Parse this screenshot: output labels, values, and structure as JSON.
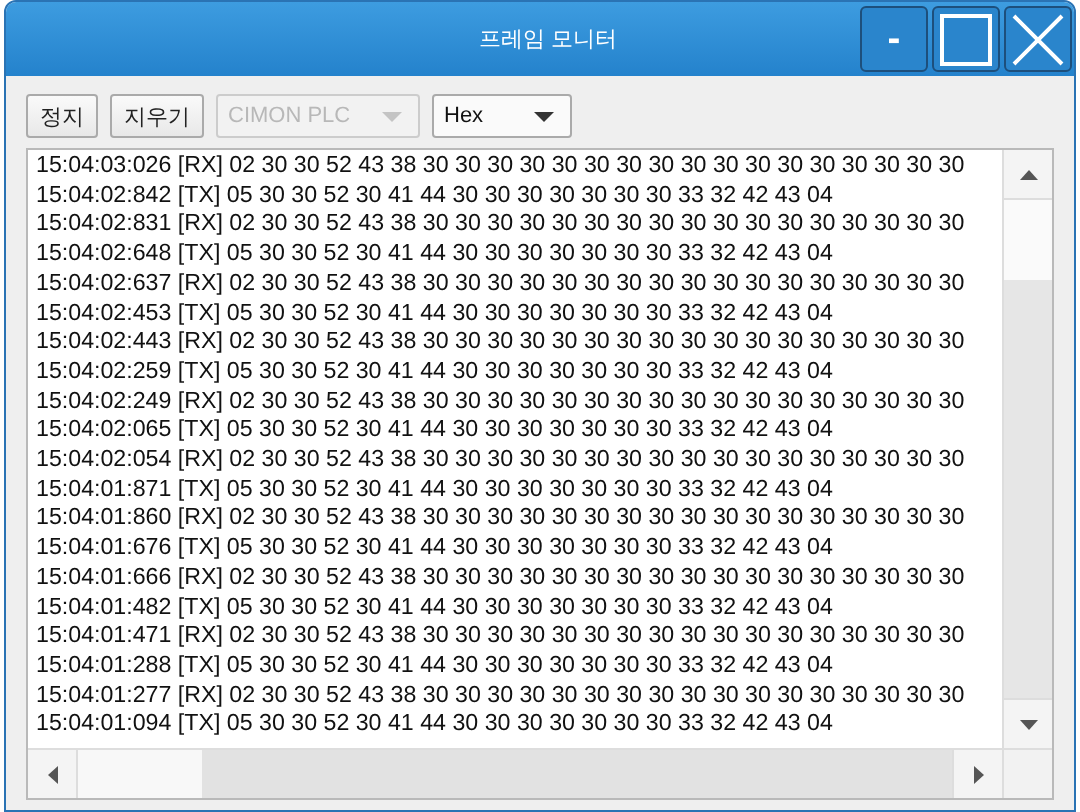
{
  "window": {
    "title": "프레임 모니터",
    "controls": [
      {
        "kind": "minimize",
        "label": "-"
      },
      {
        "kind": "maximize"
      },
      {
        "kind": "close"
      }
    ]
  },
  "toolbar": {
    "buttons": [
      "정지",
      "지우기"
    ],
    "combos": [
      {
        "value": "CIMON PLC",
        "disabled": true
      },
      {
        "value": "Hex",
        "disabled": false
      }
    ]
  },
  "log": {
    "lines": [
      "15:04:03:026 [RX] 02 30 30 52 43 38 30 30 30 30 30 30 30 30 30 30 30 30 30 30 30 30 30",
      "15:04:02:842 [TX] 05 30 30 52 30 41 44 30 30 30 30 30 30 30 33 32 42 43 04",
      "15:04:02:831 [RX] 02 30 30 52 43 38 30 30 30 30 30 30 30 30 30 30 30 30 30 30 30 30 30",
      "15:04:02:648 [TX] 05 30 30 52 30 41 44 30 30 30 30 30 30 30 33 32 42 43 04",
      "15:04:02:637 [RX] 02 30 30 52 43 38 30 30 30 30 30 30 30 30 30 30 30 30 30 30 30 30 30",
      "15:04:02:453 [TX] 05 30 30 52 30 41 44 30 30 30 30 30 30 30 33 32 42 43 04",
      "15:04:02:443 [RX] 02 30 30 52 43 38 30 30 30 30 30 30 30 30 30 30 30 30 30 30 30 30 30",
      "15:04:02:259 [TX] 05 30 30 52 30 41 44 30 30 30 30 30 30 30 33 32 42 43 04",
      "15:04:02:249 [RX] 02 30 30 52 43 38 30 30 30 30 30 30 30 30 30 30 30 30 30 30 30 30 30",
      "15:04:02:065 [TX] 05 30 30 52 30 41 44 30 30 30 30 30 30 30 33 32 42 43 04",
      "15:04:02:054 [RX] 02 30 30 52 43 38 30 30 30 30 30 30 30 30 30 30 30 30 30 30 30 30 30",
      "15:04:01:871 [TX] 05 30 30 52 30 41 44 30 30 30 30 30 30 30 33 32 42 43 04",
      "15:04:01:860 [RX] 02 30 30 52 43 38 30 30 30 30 30 30 30 30 30 30 30 30 30 30 30 30 30",
      "15:04:01:676 [TX] 05 30 30 52 30 41 44 30 30 30 30 30 30 30 33 32 42 43 04",
      "15:04:01:666 [RX] 02 30 30 52 43 38 30 30 30 30 30 30 30 30 30 30 30 30 30 30 30 30 30",
      "15:04:01:482 [TX] 05 30 30 52 30 41 44 30 30 30 30 30 30 30 33 32 42 43 04",
      "15:04:01:471 [RX] 02 30 30 52 43 38 30 30 30 30 30 30 30 30 30 30 30 30 30 30 30 30 30",
      "15:04:01:288 [TX] 05 30 30 52 30 41 44 30 30 30 30 30 30 30 33 32 42 43 04",
      "15:04:01:277 [RX] 02 30 30 52 43 38 30 30 30 30 30 30 30 30 30 30 30 30 30 30 30 30 30",
      "15:04:01:094 [TX] 05 30 30 52 30 41 44 30 30 30 30 30 30 30 33 32 42 43 04"
    ]
  }
}
